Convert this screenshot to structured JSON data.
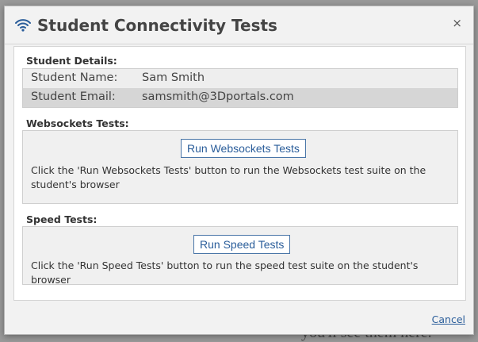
{
  "background": {
    "text": "you'll see them here."
  },
  "dialog": {
    "title": "Student Connectivity Tests",
    "close_glyph": "×",
    "cancel_label": "Cancel"
  },
  "student_details": {
    "heading": "Student Details:",
    "rows": [
      {
        "label": "Student Name:",
        "value": "Sam Smith"
      },
      {
        "label": "Student Email:",
        "value": "samsmith@3Dportals.com"
      }
    ]
  },
  "websockets": {
    "heading": "Websockets Tests:",
    "button_label": "Run Websockets Tests",
    "description": "Click the 'Run Websockets Tests' button to run the Websockets test suite on the student's browser"
  },
  "speed": {
    "heading": "Speed Tests:",
    "button_label": "Run Speed Tests",
    "description": "Click the 'Run Speed Tests' button to run the speed test suite on the student's browser"
  },
  "colors": {
    "accent": "#2a5d9a",
    "title": "#444444"
  },
  "icons": {
    "title_icon": "wifi-icon",
    "close_icon": "close-icon"
  }
}
